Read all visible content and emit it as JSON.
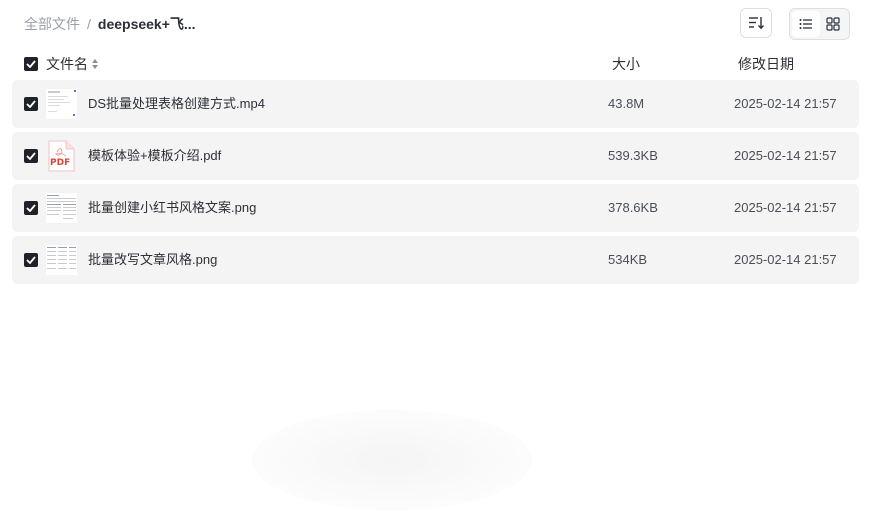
{
  "breadcrumb": {
    "root": "全部文件",
    "separator": "/",
    "current": "deepseek+飞..."
  },
  "toolbar": {
    "sort_icon": "sort-icon",
    "views": [
      "list-view",
      "grid-view"
    ],
    "active_view": "list-view"
  },
  "table": {
    "header": {
      "name": "文件名",
      "size": "大小",
      "date": "修改日期"
    },
    "rows": [
      {
        "name": "DS批量处理表格创建方式.mp4",
        "size": "43.8M",
        "date": "2025-02-14 21:57",
        "type": "video",
        "checked": true
      },
      {
        "name": "模板体验+模板介绍.pdf",
        "size": "539.3KB",
        "date": "2025-02-14 21:57",
        "type": "pdf",
        "pdf_label": "PDF",
        "checked": true
      },
      {
        "name": "批量创建小红书风格文案.png",
        "size": "378.6KB",
        "date": "2025-02-14 21:57",
        "type": "image",
        "checked": true
      },
      {
        "name": "批量改写文章风格.png",
        "size": "534KB",
        "date": "2025-02-14 21:57",
        "type": "image",
        "checked": true
      }
    ]
  },
  "colors": {
    "row_bg": "#f4f4f5",
    "checkbox": "#1f2329",
    "pdf_red": "#e0433a",
    "muted_text": "#9aa0a8"
  }
}
